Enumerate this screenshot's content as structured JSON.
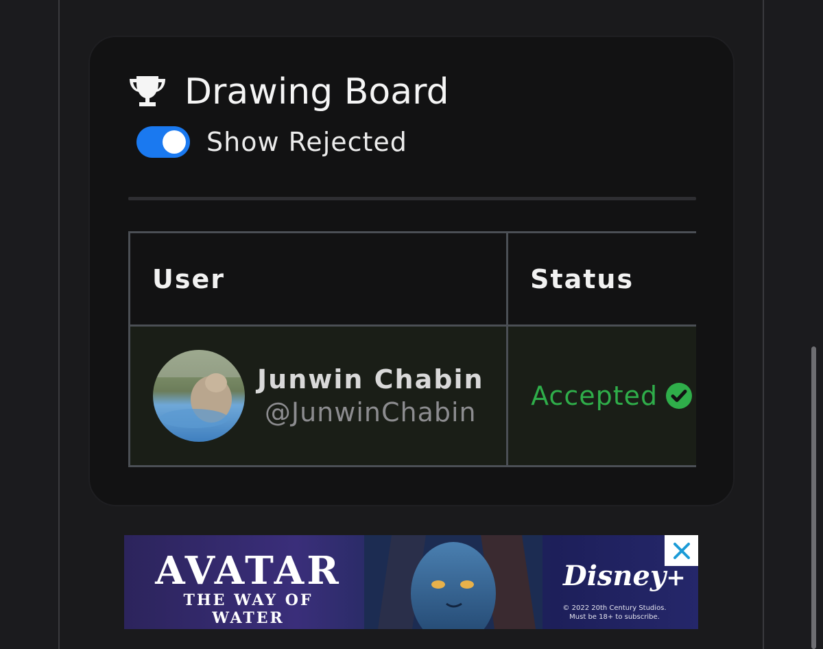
{
  "card": {
    "title": "Drawing Board",
    "toggle": {
      "label": "Show Rejected",
      "checked": true,
      "color": "#1a79f0"
    }
  },
  "table": {
    "headers": {
      "user": "User",
      "status": "Status"
    },
    "rows": [
      {
        "name": "Junwin Chabin",
        "handle": "@JunwinChabin",
        "status": "Accepted",
        "status_color": "#2fae4a"
      }
    ]
  },
  "ad": {
    "title": "AVATAR",
    "subtitle": "THE WAY OF WATER",
    "brand": "Disney",
    "brand_plus": "+",
    "legal_line1": "© 2022 20th Century Studios.",
    "legal_line2": "Must be 18+ to subscribe."
  },
  "icons": {
    "header": "trophy-icon",
    "status": "check-circle-icon",
    "close": "close-icon"
  }
}
